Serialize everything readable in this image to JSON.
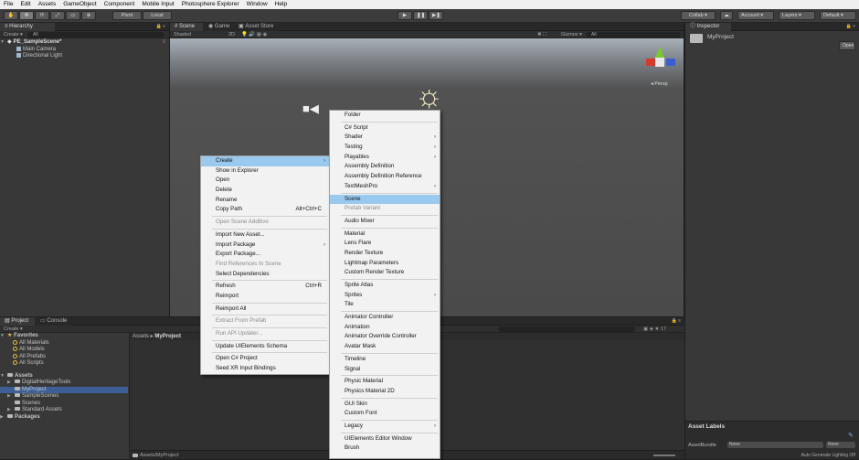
{
  "menubar": {
    "items": [
      "File",
      "Edit",
      "Assets",
      "GameObject",
      "Component",
      "Mobile Input",
      "Photosphere Explorer",
      "Window",
      "Help"
    ]
  },
  "toolbar": {
    "pivot": "Pivot",
    "local": "Local",
    "collab": "Collab ▾",
    "account": "Account",
    "layers": "Layers",
    "layout": "Default"
  },
  "hierarchy": {
    "tab": "Hierarchy",
    "create": "Create ▾",
    "search": "All",
    "scene": "PE_SampleScene*",
    "objects": [
      "Main Camera",
      "Directional Light"
    ]
  },
  "scene": {
    "tabs": [
      "Scene",
      "Game",
      "Asset Store"
    ],
    "shading": "Shaded",
    "mode": "2D",
    "gizmos": "Gizmos ▾",
    "search": "All",
    "persp": "Persp"
  },
  "inspector": {
    "tab": "Inspector",
    "name": "MyProject",
    "open": "Open",
    "asset_labels": "Asset Labels",
    "asset_bundle": "AssetBundle",
    "bundle_value": "None",
    "variant_value": "None",
    "lighting": "Auto Generate Lighting Off"
  },
  "project": {
    "tabs": [
      "Project",
      "Console"
    ],
    "create": "Create ▾",
    "favorites": {
      "label": "Favorites",
      "items": [
        "All Materials",
        "All Models",
        "All Prefabs",
        "All Scripts"
      ]
    },
    "assets": {
      "label": "Assets",
      "items": [
        "DigitalHeritageTools",
        "MyProject",
        "SampleScenes",
        "Scenes",
        "Standard Assets"
      ]
    },
    "packages": "Packages",
    "breadcrumb_root": "Assets",
    "breadcrumb_current": "MyProject",
    "footer_path": "Assets/MyProject"
  },
  "context_menu": {
    "items": [
      {
        "label": "Create",
        "arrow": "›",
        "highlight": true
      },
      {
        "label": "Show in Explorer"
      },
      {
        "label": "Open"
      },
      {
        "label": "Delete"
      },
      {
        "label": "Rename"
      },
      {
        "label": "Copy Path",
        "shortcut": "Alt+Ctrl+C"
      },
      {
        "sep": true
      },
      {
        "label": "Open Scene Additive",
        "disabled": true
      },
      {
        "sep": true
      },
      {
        "label": "Import New Asset..."
      },
      {
        "label": "Import Package",
        "arrow": "›"
      },
      {
        "label": "Export Package..."
      },
      {
        "label": "Find References In Scene",
        "disabled": true
      },
      {
        "label": "Select Dependencies"
      },
      {
        "sep": true
      },
      {
        "label": "Refresh",
        "shortcut": "Ctrl+R"
      },
      {
        "label": "Reimport"
      },
      {
        "sep": true
      },
      {
        "label": "Reimport All"
      },
      {
        "sep": true
      },
      {
        "label": "Extract From Prefab",
        "disabled": true
      },
      {
        "sep": true
      },
      {
        "label": "Run API Updater...",
        "disabled": true
      },
      {
        "sep": true
      },
      {
        "label": "Update UIElements Schema"
      },
      {
        "sep": true
      },
      {
        "label": "Open C# Project"
      },
      {
        "label": "Seed XR Input Bindings"
      }
    ]
  },
  "create_submenu": {
    "items": [
      {
        "label": "Folder"
      },
      {
        "sep": true
      },
      {
        "label": "C# Script"
      },
      {
        "label": "Shader",
        "arrow": "›"
      },
      {
        "label": "Testing",
        "arrow": "›"
      },
      {
        "label": "Playables",
        "arrow": "›"
      },
      {
        "label": "Assembly Definition"
      },
      {
        "label": "Assembly Definition Reference"
      },
      {
        "label": "TextMeshPro",
        "arrow": "›"
      },
      {
        "sep": true
      },
      {
        "label": "Scene",
        "highlight": true
      },
      {
        "label": "Prefab Variant",
        "disabled": true
      },
      {
        "sep": true
      },
      {
        "label": "Audio Mixer"
      },
      {
        "sep": true
      },
      {
        "label": "Material"
      },
      {
        "label": "Lens Flare"
      },
      {
        "label": "Render Texture"
      },
      {
        "label": "Lightmap Parameters"
      },
      {
        "label": "Custom Render Texture"
      },
      {
        "sep": true
      },
      {
        "label": "Sprite Atlas"
      },
      {
        "label": "Sprites",
        "arrow": "›"
      },
      {
        "label": "Tile"
      },
      {
        "sep": true
      },
      {
        "label": "Animator Controller"
      },
      {
        "label": "Animation"
      },
      {
        "label": "Animator Override Controller"
      },
      {
        "label": "Avatar Mask"
      },
      {
        "sep": true
      },
      {
        "label": "Timeline"
      },
      {
        "label": "Signal"
      },
      {
        "sep": true
      },
      {
        "label": "Physic Material"
      },
      {
        "label": "Physics Material 2D"
      },
      {
        "sep": true
      },
      {
        "label": "GUI Skin"
      },
      {
        "label": "Custom Font"
      },
      {
        "sep": true
      },
      {
        "label": "Legacy",
        "arrow": "›"
      },
      {
        "sep": true
      },
      {
        "label": "UIElements Editor Window"
      },
      {
        "label": "Brush"
      }
    ]
  }
}
